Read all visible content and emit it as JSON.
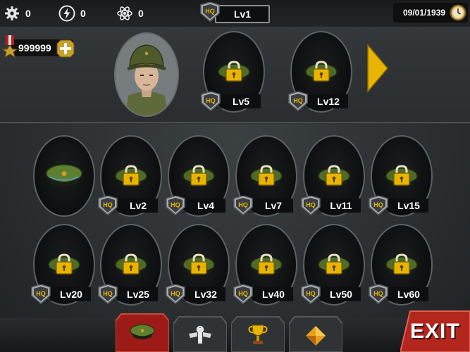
{
  "resources": [
    {
      "icon": "gear-icon",
      "value": "0"
    },
    {
      "icon": "lightning-icon",
      "value": "0"
    },
    {
      "icon": "atom-icon",
      "value": "0"
    }
  ],
  "hq": {
    "badge": "HQ",
    "level": "Lv1"
  },
  "date": "09/01/1939",
  "clock_icon": "compass-clock-icon",
  "money": {
    "icon": "medal-icon",
    "value": "999999",
    "add_icon": "plus-icon"
  },
  "upper_slots": [
    {
      "level": "Lv5",
      "locked": true
    },
    {
      "level": "Lv12",
      "locked": true
    }
  ],
  "grid_row1": [
    {
      "level": "",
      "locked": false
    },
    {
      "level": "Lv2",
      "locked": true
    },
    {
      "level": "Lv4",
      "locked": true
    },
    {
      "level": "Lv7",
      "locked": true
    },
    {
      "level": "Lv11",
      "locked": true
    },
    {
      "level": "Lv15",
      "locked": true
    }
  ],
  "grid_row2": [
    {
      "level": "Lv20",
      "locked": true
    },
    {
      "level": "Lv25",
      "locked": true
    },
    {
      "level": "Lv32",
      "locked": true
    },
    {
      "level": "Lv40",
      "locked": true
    },
    {
      "level": "Lv50",
      "locked": true
    },
    {
      "level": "Lv60",
      "locked": true
    }
  ],
  "tabs": [
    {
      "icon": "officer-cap-icon",
      "active": true
    },
    {
      "icon": "wrench-wings-icon",
      "active": false
    },
    {
      "icon": "trophy-icon",
      "active": false
    },
    {
      "icon": "diamond-icon",
      "active": false
    }
  ],
  "exit_label": "EXIT",
  "colors": {
    "gold": "#e8b400",
    "exit_red": "#b3261e",
    "active_tab": "#9c1b17",
    "cap_green": "#4f6b2a"
  }
}
